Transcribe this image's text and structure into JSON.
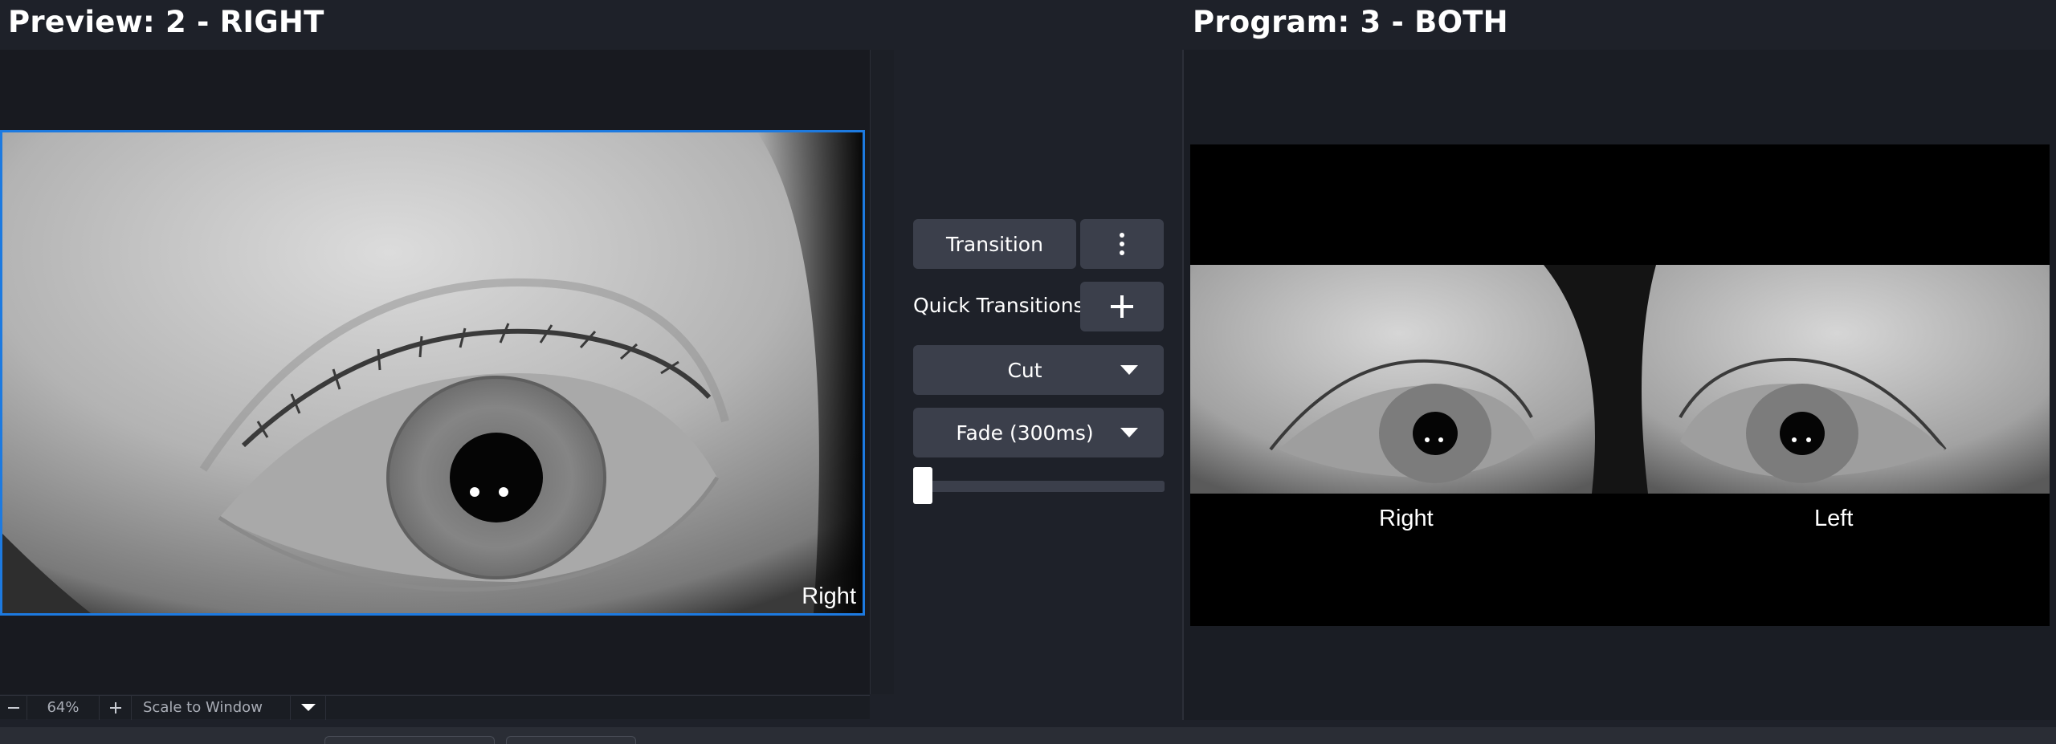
{
  "preview": {
    "title": "Preview: 2 - RIGHT",
    "eye_label": "Right",
    "zoom": {
      "minus_icon": "minus-icon",
      "level": "64%",
      "plus_icon": "plus-icon",
      "scale_mode": "Scale to Window",
      "dropdown_icon": "chevron-down-icon"
    }
  },
  "transitions": {
    "transition_label": "Transition",
    "menu_icon": "vertical-dots-icon",
    "quick_transitions_label": "Quick Transitions",
    "add_icon": "plus-icon",
    "cut_label": "Cut",
    "fade_label": "Fade (300ms)",
    "t_bar_position": 0
  },
  "program": {
    "title": "Program: 3 - BOTH",
    "right_label": "Right",
    "left_label": "Left"
  },
  "colors": {
    "accent": "#1d7ae0",
    "background": "#1e2129",
    "button": "#3b3f4b"
  }
}
